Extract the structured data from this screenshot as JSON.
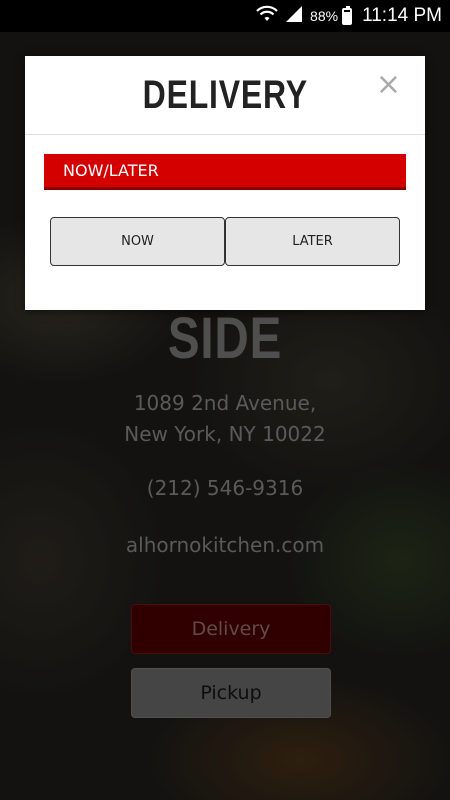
{
  "status_bar": {
    "battery": "88%",
    "time": "11:14 PM",
    "icons": [
      "wifi-icon",
      "signal-icon",
      "battery-icon"
    ]
  },
  "background": {
    "store_name": "SIDE",
    "address_line1": "1089 2nd Avenue,",
    "address_line2": "New York, NY 10022",
    "phone": "(212) 546-9316",
    "website": "alhornokitchen.com",
    "delivery_button": "Delivery",
    "pickup_button": "Pickup"
  },
  "modal": {
    "title": "DELIVERY",
    "close": "×",
    "section_label": "NOW/LATER",
    "options": [
      "NOW",
      "LATER"
    ]
  },
  "colors": {
    "accent_red": "#d40000",
    "modal_bg": "#ffffff"
  }
}
